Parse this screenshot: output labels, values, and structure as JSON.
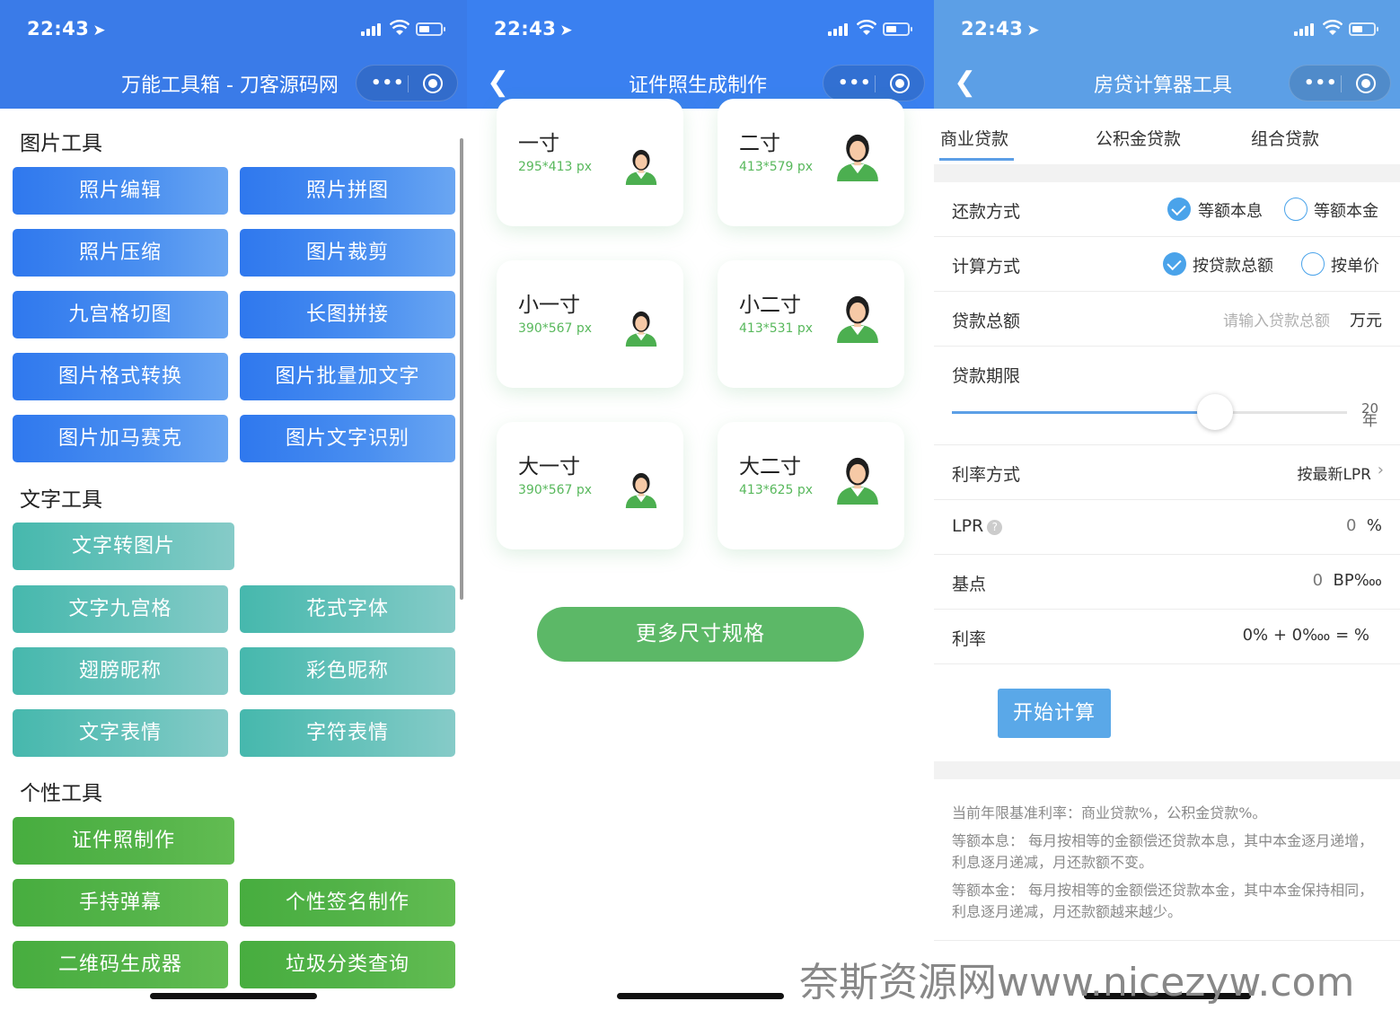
{
  "status": {
    "time": "22:43"
  },
  "screen1": {
    "nav_title": "万能工具箱 - 刀客源码网",
    "sections": [
      {
        "title": "图片工具",
        "buttons": [
          "照片编辑",
          "照片拼图",
          "照片压缩",
          "图片裁剪",
          "九宫格切图",
          "长图拼接",
          "图片格式转换",
          "图片批量加文字",
          "图片加马赛克",
          "图片文字识别"
        ]
      },
      {
        "title": "文字工具",
        "buttons": [
          "文字转图片",
          "文字九宫格",
          "花式字体",
          "翅膀昵称",
          "彩色昵称",
          "文字表情",
          "字符表情"
        ]
      },
      {
        "title": "个性工具",
        "buttons": [
          "证件照制作",
          "手持弹幕",
          "个性签名制作",
          "二维码生成器",
          "垃圾分类查询"
        ]
      }
    ]
  },
  "screen2": {
    "nav_title": "证件照生成制作",
    "cards": [
      {
        "name": "一寸",
        "size": "295*413 px"
      },
      {
        "name": "二寸",
        "size": "413*579 px"
      },
      {
        "name": "小一寸",
        "size": "390*567 px"
      },
      {
        "name": "小二寸",
        "size": "413*531 px"
      },
      {
        "name": "大一寸",
        "size": "390*567 px"
      },
      {
        "name": "大二寸",
        "size": "413*625 px"
      }
    ],
    "more_button": "更多尺寸规格"
  },
  "screen3": {
    "nav_title": "房贷计算器工具",
    "tabs": [
      "商业贷款",
      "公积金贷款",
      "组合贷款"
    ],
    "repay": {
      "label": "还款方式",
      "opt1": "等额本息",
      "opt2": "等额本金"
    },
    "calc_mode": {
      "label": "计算方式",
      "opt1": "按贷款总额",
      "opt2": "按单价"
    },
    "amount": {
      "label": "贷款总额",
      "placeholder": "请输入贷款总额",
      "unit": "万元"
    },
    "term": {
      "label": "贷款期限",
      "value": "20",
      "unit": "年",
      "slider_fraction": 0.667
    },
    "rate_mode": {
      "label": "利率方式",
      "value": "按最新LPR"
    },
    "lpr": {
      "label": "LPR",
      "value": "0",
      "unit": "%"
    },
    "bp": {
      "label": "基点",
      "value": "0",
      "unit": "BP‱"
    },
    "rate": {
      "label": "利率",
      "value": "0% + 0‱ = %"
    },
    "calc_button": "开始计算",
    "notes": [
      "当前年限基准利率：商业贷款%，公积金贷款%。",
      "等额本息：  每月按相等的金额偿还贷款本息，其中本金逐月递增，利息逐月递减，月还款额不变。",
      "等额本金：  每月按相等的金额偿还贷款本金，其中本金保持相同，利息逐月递减，月还款额越来越少。"
    ]
  },
  "watermark": "奈斯资源网www.nicezyw.com",
  "colors": {
    "blue": "#3a7be8",
    "teal": "#5bbfb5",
    "green": "#4fb146",
    "accent": "#5c9fe6"
  }
}
